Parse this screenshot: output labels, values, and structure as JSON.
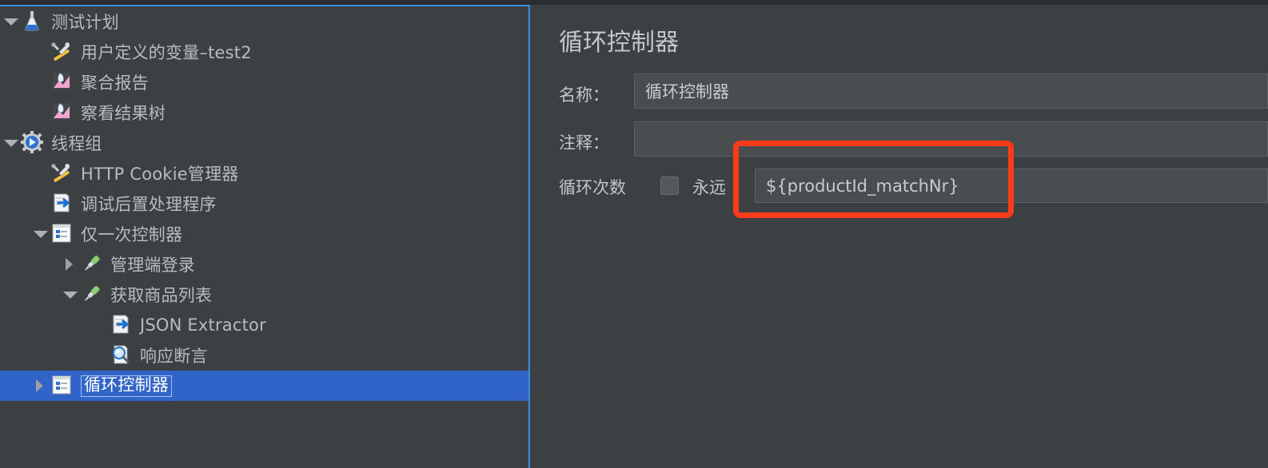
{
  "app": {
    "tree_panel_focus_color": "#3c8ddc",
    "selection_color": "#3064c8",
    "highlight_color": "#fa3b19",
    "background_color": "#3c4043"
  },
  "tree": {
    "items": [
      {
        "label": "测试计划",
        "depth": 0,
        "twisty": "down",
        "icon": "test-plan-flask-icon"
      },
      {
        "label": "用户定义的变量–test2",
        "depth": 1,
        "twisty": "none",
        "icon": "config-element-tools-icon"
      },
      {
        "label": "聚合报告",
        "depth": 1,
        "twisty": "none",
        "icon": "listener-chart-icon"
      },
      {
        "label": "察看结果树",
        "depth": 1,
        "twisty": "none",
        "icon": "listener-chart-icon"
      },
      {
        "label": "线程组",
        "depth": 0,
        "twisty": "down",
        "icon": "thread-group-gear-icon"
      },
      {
        "label": "HTTP Cookie管理器",
        "depth": 1,
        "twisty": "none",
        "icon": "config-element-tools-icon"
      },
      {
        "label": "调试后置处理程序",
        "depth": 1,
        "twisty": "none",
        "icon": "post-processor-icon"
      },
      {
        "label": "仅一次控制器",
        "depth": 1,
        "twisty": "down",
        "icon": "controller-icon"
      },
      {
        "label": "管理端登录",
        "depth": 2,
        "twisty": "right",
        "icon": "http-sampler-icon"
      },
      {
        "label": "获取商品列表",
        "depth": 2,
        "twisty": "down",
        "icon": "http-sampler-icon"
      },
      {
        "label": "JSON Extractor",
        "depth": 3,
        "twisty": "none",
        "icon": "post-processor-icon"
      },
      {
        "label": "响应断言",
        "depth": 3,
        "twisty": "none",
        "icon": "assertion-magnifier-icon"
      },
      {
        "label": "循环控制器",
        "depth": 1,
        "twisty": "right",
        "icon": "controller-icon",
        "selected": true
      }
    ]
  },
  "detail": {
    "title": "循环控制器",
    "name_label": "名称：",
    "name_value": "循环控制器",
    "comment_label": "注释：",
    "comment_value": "",
    "loop_count_label": "循环次数",
    "forever_label": "永远",
    "forever_checked": false,
    "loop_count_value": "${productId_matchNr}"
  }
}
